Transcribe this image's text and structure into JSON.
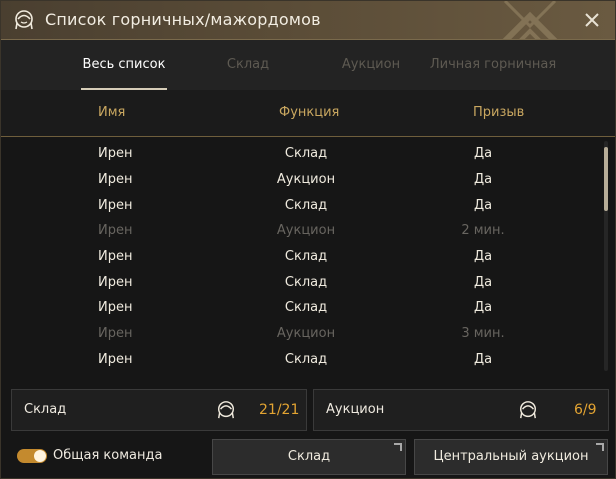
{
  "window": {
    "title": "Список горничных/мажордомов",
    "close_icon": "close-icon",
    "title_icon": "maid-icon"
  },
  "tabs": [
    {
      "label": "Весь список",
      "active": true
    },
    {
      "label": "Склад",
      "active": false
    },
    {
      "label": "Аукцион",
      "active": false
    },
    {
      "label": "Личная горничная",
      "active": false
    }
  ],
  "table": {
    "headers": {
      "name": "Имя",
      "function": "Функция",
      "summon": "Призыв"
    },
    "rows": [
      {
        "name": "Ирен",
        "function": "Склад",
        "summon": "Да",
        "available": true
      },
      {
        "name": "Ирен",
        "function": "Аукцион",
        "summon": "Да",
        "available": true
      },
      {
        "name": "Ирен",
        "function": "Склад",
        "summon": "Да",
        "available": true
      },
      {
        "name": "Ирен",
        "function": "Аукцион",
        "summon": "2 мин.",
        "available": false
      },
      {
        "name": "Ирен",
        "function": "Склад",
        "summon": "Да",
        "available": true
      },
      {
        "name": "Ирен",
        "function": "Склад",
        "summon": "Да",
        "available": true
      },
      {
        "name": "Ирен",
        "function": "Склад",
        "summon": "Да",
        "available": true
      },
      {
        "name": "Ирен",
        "function": "Аукцион",
        "summon": "3 мин.",
        "available": false
      },
      {
        "name": "Ирен",
        "function": "Склад",
        "summon": "Да",
        "available": true
      }
    ]
  },
  "summary": {
    "storage": {
      "label": "Склад",
      "count": "21/21",
      "icon": "maid-icon"
    },
    "auction": {
      "label": "Аукцион",
      "count": "6/9",
      "icon": "maid-icon"
    }
  },
  "footer": {
    "toggle_label": "Общая команда",
    "toggle_on": true,
    "storage_button": "Склад",
    "auction_button": "Центральный аукцион"
  },
  "colors": {
    "accent_gold": "#c9a760",
    "count_orange": "#e3a432",
    "title_bar": "#5a4c37"
  }
}
